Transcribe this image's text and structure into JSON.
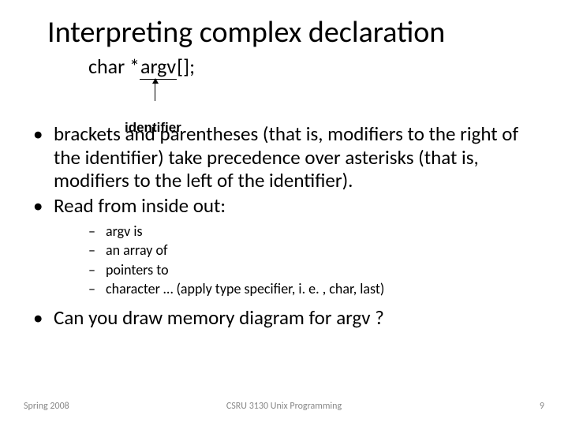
{
  "title": "Interpreting complex declaration",
  "decl_prefix": "char *",
  "decl_ident": "argv",
  "decl_suffix": "[];",
  "identifier_label": "identifier",
  "bullets": {
    "b1": "brackets and parentheses (that is, modifiers to the right of the identifier) take precedence over asterisks (that is, modifiers to the left of the identifier).",
    "b2": "Read from inside out:",
    "sub": [
      "argv is",
      "an array of",
      "pointers to",
      "character …  (apply type specifier, i. e. , char, last)"
    ],
    "b3": "Can you draw memory diagram for argv ?"
  },
  "footer": {
    "left": "Spring 2008",
    "center": "CSRU 3130 Unix Programming",
    "right": "9"
  }
}
